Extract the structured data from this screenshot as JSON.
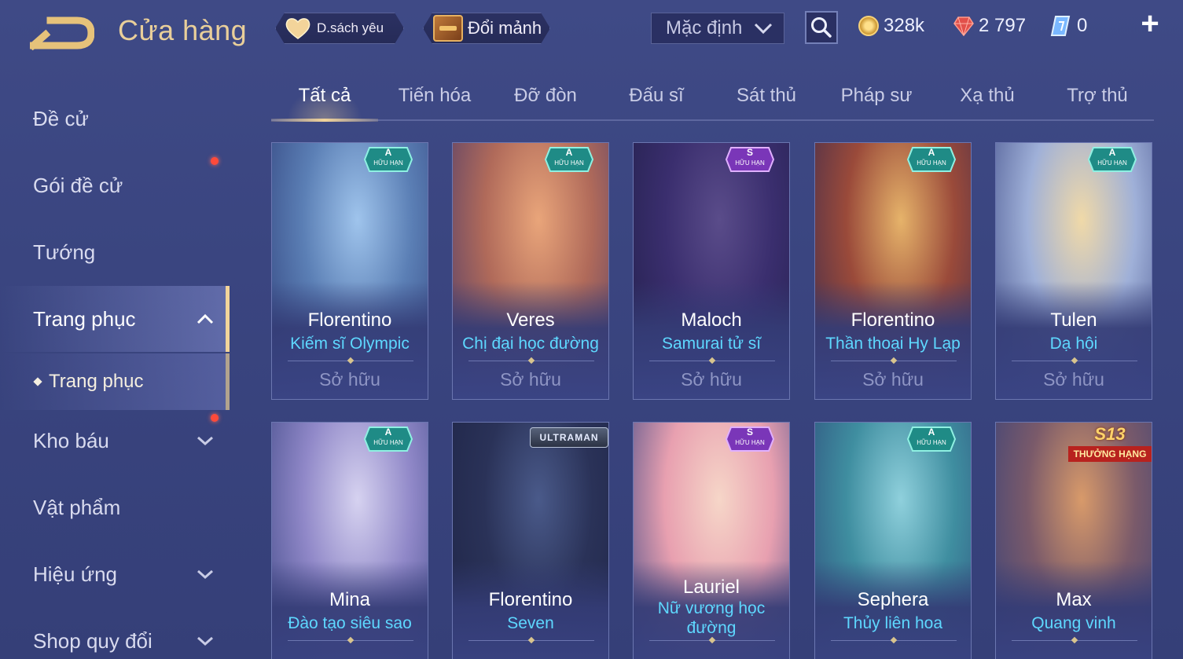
{
  "header": {
    "title": "Cửa hàng",
    "favorites_label": "D.sách yêu",
    "exchange_label": "Đổi mảnh",
    "sort_value": "Mặc định",
    "currencies": {
      "gold": "328k",
      "gems": "2 797",
      "tickets": "0"
    }
  },
  "sidebar": {
    "items": [
      {
        "label": "Đề cử"
      },
      {
        "label": "Gói đề cử"
      },
      {
        "label": "Tướng"
      },
      {
        "label": "Trang phục"
      },
      {
        "label": "Trang phục"
      },
      {
        "label": "Kho báu"
      },
      {
        "label": "Vật phẩm"
      },
      {
        "label": "Hiệu ứng"
      },
      {
        "label": "Shop quy đổi"
      }
    ]
  },
  "tabs": [
    {
      "label": "Tất cả"
    },
    {
      "label": "Tiến hóa"
    },
    {
      "label": "Đỡ đòn"
    },
    {
      "label": "Đấu sĩ"
    },
    {
      "label": "Sát thủ"
    },
    {
      "label": "Pháp sư"
    },
    {
      "label": "Xạ thủ"
    },
    {
      "label": "Trợ thủ"
    }
  ],
  "cards": [
    {
      "hero": "Florentino",
      "skin": "Kiếm sĩ Olympic",
      "status": "Sở hữu",
      "badge_grade": "A",
      "badge_note": "HỮU HẠN",
      "palette": [
        "#9fc4ec",
        "#5b7fb5",
        "#2f3f7a"
      ]
    },
    {
      "hero": "Veres",
      "skin": "Chị đại học đường",
      "status": "Sở hữu",
      "badge_grade": "A",
      "badge_note": "HỮU HẠN",
      "palette": [
        "#e9a57a",
        "#b06a5a",
        "#4a3a6a"
      ]
    },
    {
      "hero": "Maloch",
      "skin": "Samurai tử sĩ",
      "status": "Sở hữu",
      "badge_grade": "S",
      "badge_note": "HỮU HẠN",
      "palette": [
        "#5a4c8a",
        "#3a2e6e",
        "#22204a"
      ]
    },
    {
      "hero": "Florentino",
      "skin": "Thần thoại Hy Lạp",
      "status": "Sở hữu",
      "badge_grade": "A",
      "badge_note": "HỮU HẠN",
      "palette": [
        "#e6b36a",
        "#9a4a3a",
        "#3a2a4e"
      ]
    },
    {
      "hero": "Tulen",
      "skin": "Dạ hội",
      "status": "Sở hữu",
      "badge_grade": "A",
      "badge_note": "HỮU HẠN",
      "palette": [
        "#f0d9a8",
        "#9fb0d8",
        "#3e4a86"
      ]
    },
    {
      "hero": "Mina",
      "skin": "Đào tạo siêu sao",
      "status": "",
      "badge_grade": "A",
      "badge_note": "HỮU HẠN",
      "palette": [
        "#d6d2f0",
        "#9088c8",
        "#3c4684"
      ]
    },
    {
      "hero": "Florentino",
      "skin": "Seven",
      "status": "",
      "badge_text": "ULTRAMAN",
      "palette": [
        "#4a5a8a",
        "#2a3258",
        "#1e2446"
      ]
    },
    {
      "hero": "Lauriel",
      "skin": "Nữ vương học đường",
      "status": "",
      "badge_grade": "S",
      "badge_note": "HỮU HẠN",
      "palette": [
        "#f6d6c8",
        "#e8a0b0",
        "#3c4684"
      ]
    },
    {
      "hero": "Sephera",
      "skin": "Thủy liên hoa",
      "status": "",
      "badge_grade": "A",
      "badge_note": "HỮU HẠN",
      "palette": [
        "#8fd0dc",
        "#3f8ea0",
        "#2e4a7a"
      ]
    },
    {
      "hero": "Max",
      "skin": "Quang vinh",
      "status": "",
      "badge_season": "S13",
      "badge_ribbon": "THƯỞNG HẠNG",
      "palette": [
        "#d89a6a",
        "#7a5a6a",
        "#34407a"
      ]
    }
  ]
}
